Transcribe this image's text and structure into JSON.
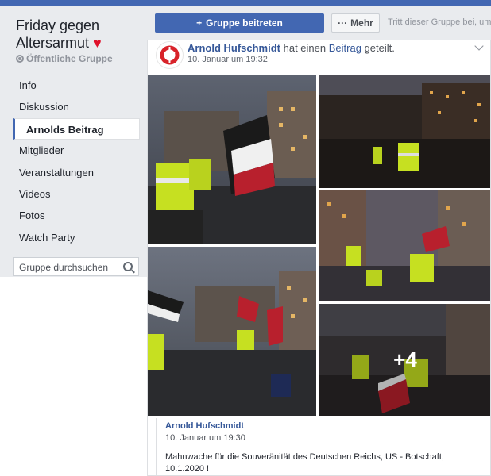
{
  "group": {
    "name": "Friday gegen Altersarmut",
    "privacy": "Öffentliche Gruppe"
  },
  "nav": {
    "items": [
      {
        "label": "Info"
      },
      {
        "label": "Diskussion"
      },
      {
        "label": "Arnolds Beitrag",
        "active": true
      },
      {
        "label": "Mitglieder"
      },
      {
        "label": "Veranstaltungen"
      },
      {
        "label": "Videos"
      },
      {
        "label": "Fotos"
      },
      {
        "label": "Watch Party"
      }
    ]
  },
  "search": {
    "placeholder": "Gruppe durchsuchen"
  },
  "actions": {
    "join_label": "Gruppe beitreten",
    "more_label": "Mehr",
    "join_hint": "Tritt dieser Gruppe bei, um"
  },
  "post": {
    "author": "Arnold Hufschmidt",
    "shared_text": "hat einen",
    "post_link": "Beitrag",
    "shared_suffix": "geteilt.",
    "timestamp": "10. Januar um 19:32",
    "more_photos": "+4",
    "shared_post": {
      "author": "Arnold Hufschmidt",
      "timestamp": "10. Januar um 19:30",
      "text": "Mahnwache für die Souveränität des Deutschen Reichs, US - Botschaft, 10.1.2020 !"
    }
  },
  "colors": {
    "brand": "#4267b2",
    "link": "#365899",
    "heart": "#e0112b"
  }
}
